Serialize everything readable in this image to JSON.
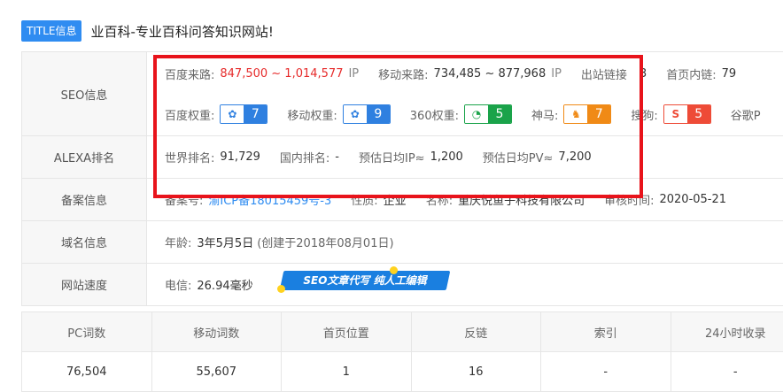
{
  "title": {
    "badge": "TITLE信息",
    "text": "业百科-专业百科问答知识网站!"
  },
  "labels": {
    "seo": "SEO信息",
    "alexa": "ALEXA排名",
    "beian": "备案信息",
    "domain": "域名信息",
    "speed": "网站速度"
  },
  "seo": {
    "baidu_traffic_label": "百度来路:",
    "baidu_traffic_value": "847,500 ~ 1,014,577",
    "baidu_traffic_unit": "IP",
    "mobile_traffic_label": "移动来路:",
    "mobile_traffic_value": "734,485 ~ 877,968",
    "mobile_traffic_unit": "IP",
    "outlinks_label": "出站链接",
    "outlinks_value": "3",
    "homepage_links_label": "首页内链:",
    "homepage_links_value": "79",
    "baidu_weight_label": "百度权重:",
    "baidu_weight_value": "7",
    "mobile_weight_label": "移动权重:",
    "mobile_weight_value": "9",
    "so360_weight_label": "360权重:",
    "so360_weight_value": "5",
    "shenma_label": "神马:",
    "shenma_value": "7",
    "sogou_label": "搜狗:",
    "sogou_value": "5",
    "google_label": "谷歌P"
  },
  "alexa": {
    "world_rank_label": "世界排名:",
    "world_rank_value": "91,729",
    "domestic_rank_label": "国内排名:",
    "domestic_rank_value": "-",
    "daily_ip_label": "预估日均IP≈",
    "daily_ip_value": "1,200",
    "daily_pv_label": "预估日均PV≈",
    "daily_pv_value": "7,200"
  },
  "beian": {
    "number_label": "备案号:",
    "number_value": "渝ICP备18015459号-3",
    "nature_label": "性质:",
    "nature_value": "企业",
    "name_label": "名称:",
    "name_value": "重庆悦鱼子科技有限公司",
    "audit_label": "审核时间:",
    "audit_value": "2020-05-21"
  },
  "domain_info": {
    "age_label": "年龄:",
    "age_value": "3年5月5日",
    "created_note": "(创建于2018年08月01日)"
  },
  "speed": {
    "telecom_label": "电信:",
    "telecom_value": "26.94毫秒",
    "banner_text": "SEO文章代写  纯人工编辑"
  },
  "stats": {
    "headers": [
      "PC词数",
      "移动词数",
      "首页位置",
      "反链",
      "索引",
      "24小时收录"
    ],
    "values": [
      "76,504",
      "55,607",
      "1",
      "16",
      "-",
      "-"
    ]
  },
  "colors": {
    "accent": "#2f8cf1",
    "highlight": "#e8131b",
    "red_value": "#e62a2a"
  }
}
